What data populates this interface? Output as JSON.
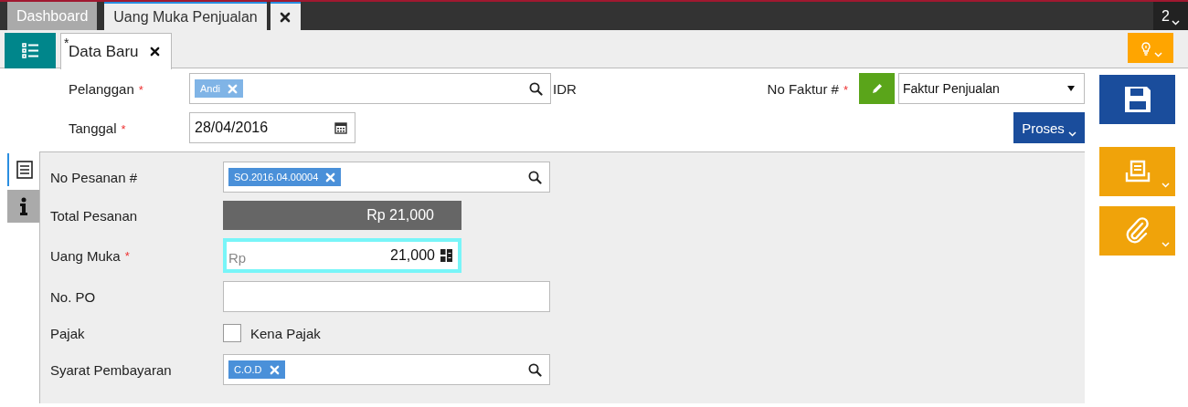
{
  "window_tabs": [
    {
      "label": "Dashboard",
      "selected": false
    },
    {
      "label": "Uang Muka Penjualan",
      "selected": true
    }
  ],
  "tab_count": "2",
  "doc_tabs": [
    {
      "label": "Data Baru",
      "modified_mark": "*",
      "selected": true
    }
  ],
  "required_mark": "*",
  "header": {
    "customer": {
      "label": "Pelanggan",
      "required": true,
      "tags": [
        "Andi"
      ]
    },
    "currency": "IDR",
    "date": {
      "label": "Tanggal",
      "required": true,
      "value": "28/04/2016"
    },
    "invoice_no": {
      "label": "No Faktur #",
      "required": true,
      "value": "Faktur Penjualan"
    },
    "process_button": "Proses"
  },
  "side_tabs": [
    {
      "kind": "list",
      "selected": true
    },
    {
      "kind": "info",
      "selected": false
    }
  ],
  "fields": [
    {
      "kind": "lookup",
      "label": "No Pesanan #",
      "required": false,
      "tags": [
        "SO.2016.04.00004"
      ]
    },
    {
      "kind": "readonly",
      "label": "Total Pesanan",
      "required": false,
      "value": "Rp 21,000"
    },
    {
      "kind": "amount",
      "label": "Uang Muka",
      "required": true,
      "prefix": "Rp",
      "value": "21,000",
      "focused": true
    },
    {
      "kind": "text",
      "label": "No. PO",
      "required": false
    },
    {
      "kind": "checkbox",
      "label": "Pajak",
      "required": false,
      "option": "Kena Pajak",
      "checked": false
    },
    {
      "kind": "lookup",
      "label": "Syarat Pembayaran",
      "required": false,
      "tags": [
        "C.O.D"
      ]
    }
  ]
}
